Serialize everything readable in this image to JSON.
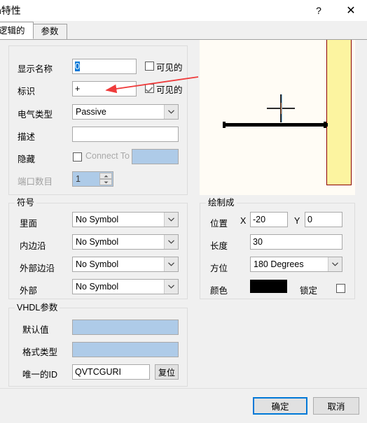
{
  "window": {
    "title": "n特性",
    "help_button": "?",
    "close_button": "✕"
  },
  "tabs": [
    {
      "label": "逻辑的",
      "active": true
    },
    {
      "label": "参数",
      "active": false
    }
  ],
  "logical_group": {
    "rows": {
      "display_name": {
        "label": "显示名称",
        "value": "0",
        "visible_label": "可见的",
        "visible_checked": false
      },
      "designator": {
        "label": "标识",
        "value": "+",
        "visible_label": "可见的",
        "visible_checked": true
      },
      "electrical_type": {
        "label": "电气类型",
        "value": "Passive"
      },
      "description": {
        "label": "描述",
        "value": ""
      },
      "hide": {
        "label": "隐藏",
        "checked": false,
        "connect_to_label": "Connect To",
        "connect_to_value": ""
      },
      "port_count": {
        "label": "端口数目",
        "value": "1",
        "disabled": true
      }
    }
  },
  "symbol_group": {
    "legend": "符号",
    "rows": [
      {
        "label": "里面",
        "value": "No Symbol"
      },
      {
        "label": "内边沿",
        "value": "No Symbol"
      },
      {
        "label": "外部边沿",
        "value": "No Symbol"
      },
      {
        "label": "外部",
        "value": "No Symbol"
      }
    ]
  },
  "vhdl_group": {
    "legend": "VHDL参数",
    "rows": [
      {
        "label": "默认值",
        "value": ""
      },
      {
        "label": "格式类型",
        "value": ""
      },
      {
        "label": "唯一的ID",
        "value": "QVTCGURI"
      }
    ],
    "reset_button": "复位"
  },
  "graphical_group": {
    "legend": "绘制成",
    "position_label": "位置",
    "x_label": "X",
    "x_value": "-20",
    "y_label": "Y",
    "y_value": "0",
    "length_label": "长度",
    "length_value": "30",
    "orientation_label": "方位",
    "orientation_value": "180 Degrees",
    "color_label": "颜色",
    "color_value": "#000000",
    "lock_label": "锁定",
    "lock_checked": false
  },
  "preview": {
    "name": "pin-preview",
    "pin_line_color": "#000000",
    "highlight_color": "#fcf4a0",
    "highlight_border": "#8b0000",
    "background": "#fffcf5"
  },
  "footer": {
    "ok_button": "确定",
    "cancel_button": "取消"
  },
  "annotation": {
    "arrow_color": "#ef3b3b"
  }
}
